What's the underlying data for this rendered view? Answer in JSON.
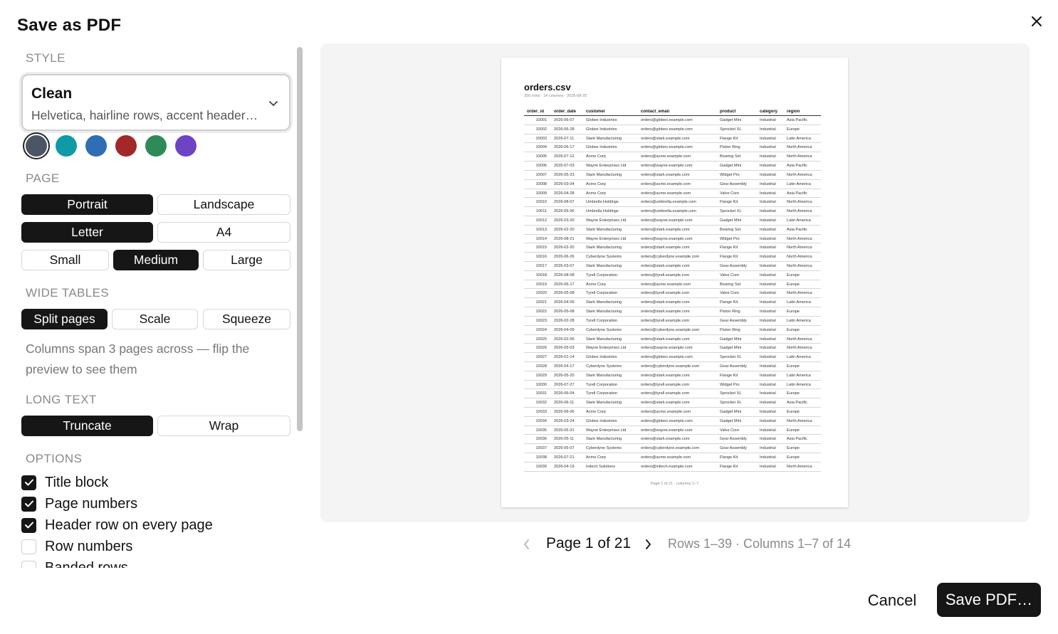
{
  "dialog": {
    "title": "Save as PDF"
  },
  "sections": {
    "style": "STYLE",
    "page": "PAGE",
    "wide_tables": "WIDE TABLES",
    "long_text": "LONG TEXT",
    "options": "OPTIONS"
  },
  "style_picker": {
    "name": "Clean",
    "description": "Helvetica, hairline rows, accent header…"
  },
  "swatches": [
    {
      "name": "slate",
      "color": "#4b5563",
      "selected": true
    },
    {
      "name": "teal",
      "color": "#0e9aa7",
      "selected": false
    },
    {
      "name": "blue",
      "color": "#2f6db5",
      "selected": false
    },
    {
      "name": "red",
      "color": "#a3282a",
      "selected": false
    },
    {
      "name": "green",
      "color": "#2e8b57",
      "selected": false
    },
    {
      "name": "purple",
      "color": "#6c44c4",
      "selected": false
    }
  ],
  "page": {
    "orientation": [
      "Portrait",
      "Landscape"
    ],
    "orientation_selected": "Portrait",
    "paper": [
      "Letter",
      "A4"
    ],
    "paper_selected": "Letter",
    "size": [
      "Small",
      "Medium",
      "Large"
    ],
    "size_selected": "Medium"
  },
  "wide_tables": {
    "modes": [
      "Split pages",
      "Scale",
      "Squeeze"
    ],
    "selected": "Split pages",
    "hint": "Columns span 3 pages across — flip the preview to see them"
  },
  "long_text": {
    "modes": [
      "Truncate",
      "Wrap"
    ],
    "selected": "Truncate"
  },
  "options": [
    {
      "label": "Title block",
      "checked": true
    },
    {
      "label": "Page numbers",
      "checked": true
    },
    {
      "label": "Header row on every page",
      "checked": true
    },
    {
      "label": "Row numbers",
      "checked": false
    },
    {
      "label": "Banded rows",
      "checked": false
    }
  ],
  "preview": {
    "doc_title": "orders.csv",
    "doc_meta": "250 rows · 14 columns · 2026-08-25",
    "columns": [
      "order_id",
      "order_date",
      "customer",
      "contact_email",
      "product",
      "category",
      "region"
    ],
    "rows": [
      [
        "10001",
        "2026-06-07",
        "Globex Industries",
        "orders@globex.example.com",
        "Gadget Mini",
        "Industrial",
        "Asia Pacific"
      ],
      [
        "10002",
        "2026-06-28",
        "Globex Industries",
        "orders@globex.example.com",
        "Sprocket XL",
        "Industrial",
        "Europe"
      ],
      [
        "10003",
        "2026-07-11",
        "Stark Manufacturing",
        "orders@stark.example.com",
        "Flange Kit",
        "Industrial",
        "Latin America"
      ],
      [
        "10004",
        "2026-06-17",
        "Globex Industries",
        "orders@globex.example.com",
        "Piston Ring",
        "Industrial",
        "North America"
      ],
      [
        "10005",
        "2026-07-12",
        "Acme Corp",
        "orders@acme.example.com",
        "Bearing Set",
        "Industrial",
        "North America"
      ],
      [
        "10006",
        "2026-07-03",
        "Wayne Enterprises Ltd",
        "orders@wayne.example.com",
        "Gadget Mini",
        "Industrial",
        "Asia Pacific"
      ],
      [
        "10007",
        "2026-05-23",
        "Stark Manufacturing",
        "orders@stark.example.com",
        "Widget Pro",
        "Industrial",
        "North America"
      ],
      [
        "10008",
        "2026-03-04",
        "Acme Corp",
        "orders@acme.example.com",
        "Gear Assembly",
        "Industrial",
        "Latin America"
      ],
      [
        "10009",
        "2026-04-28",
        "Acme Corp",
        "orders@acme.example.com",
        "Valve Core",
        "Industrial",
        "Asia Pacific"
      ],
      [
        "10010",
        "2026-08-07",
        "Umbrella Holdings",
        "orders@umbrella.example.com",
        "Flange Kit",
        "Industrial",
        "North America"
      ],
      [
        "10011",
        "2026-05-06",
        "Umbrella Holdings",
        "orders@umbrella.example.com",
        "Sprocket XL",
        "Industrial",
        "North America"
      ],
      [
        "10012",
        "2026-03-20",
        "Wayne Enterprises Ltd",
        "orders@wayne.example.com",
        "Gadget Mini",
        "Industrial",
        "Latin America"
      ],
      [
        "10013",
        "2026-02-20",
        "Stark Manufacturing",
        "orders@stark.example.com",
        "Bearing Set",
        "Industrial",
        "Asia Pacific"
      ],
      [
        "10014",
        "2026-08-21",
        "Wayne Enterprises Ltd",
        "orders@wayne.example.com",
        "Widget Pro",
        "Industrial",
        "North America"
      ],
      [
        "10015",
        "2026-02-20",
        "Stark Manufacturing",
        "orders@stark.example.com",
        "Flange Kit",
        "Industrial",
        "North America"
      ],
      [
        "10016",
        "2026-06-26",
        "Cyberdyne Systems",
        "orders@cyberdyne.example.com",
        "Flange Kit",
        "Industrial",
        "North America"
      ],
      [
        "10017",
        "2026-03-07",
        "Stark Manufacturing",
        "orders@stark.example.com",
        "Gear Assembly",
        "Industrial",
        "North America"
      ],
      [
        "10018",
        "2026-08-08",
        "Tyrell Corporation",
        "orders@tyrell.example.com",
        "Valve Core",
        "Industrial",
        "Europe"
      ],
      [
        "10019",
        "2026-06-17",
        "Acme Corp",
        "orders@acme.example.com",
        "Bearing Set",
        "Industrial",
        "Europe"
      ],
      [
        "10020",
        "2026-05-08",
        "Tyrell Corporation",
        "orders@tyrell.example.com",
        "Valve Core",
        "Industrial",
        "North America"
      ],
      [
        "10021",
        "2026-04-05",
        "Stark Manufacturing",
        "orders@stark.example.com",
        "Flange Kit",
        "Industrial",
        "Latin America"
      ],
      [
        "10022",
        "2026-05-08",
        "Stark Manufacturing",
        "orders@stark.example.com",
        "Piston Ring",
        "Industrial",
        "Europe"
      ],
      [
        "10023",
        "2026-02-28",
        "Tyrell Corporation",
        "orders@tyrell.example.com",
        "Gear Assembly",
        "Industrial",
        "Latin America"
      ],
      [
        "10024",
        "2026-04-09",
        "Cyberdyne Systems",
        "orders@cyberdyne.example.com",
        "Piston Ring",
        "Industrial",
        "Europe"
      ],
      [
        "10025",
        "2026-02-06",
        "Stark Manufacturing",
        "orders@stark.example.com",
        "Gadget Mini",
        "Industrial",
        "North America"
      ],
      [
        "10026",
        "2026-05-03",
        "Wayne Enterprises Ltd",
        "orders@wayne.example.com",
        "Gadget Mini",
        "Industrial",
        "North America"
      ],
      [
        "10027",
        "2026-01-14",
        "Globex Industries",
        "orders@globex.example.com",
        "Sprocket XL",
        "Industrial",
        "Latin America"
      ],
      [
        "10028",
        "2026-04-17",
        "Cyberdyne Systems",
        "orders@cyberdyne.example.com",
        "Gear Assembly",
        "Industrial",
        "Europe"
      ],
      [
        "10029",
        "2026-05-20",
        "Stark Manufacturing",
        "orders@stark.example.com",
        "Flange Kit",
        "Industrial",
        "Latin America"
      ],
      [
        "10030",
        "2026-07-27",
        "Tyrell Corporation",
        "orders@tyrell.example.com",
        "Widget Pro",
        "Industrial",
        "Latin America"
      ],
      [
        "10031",
        "2026-06-04",
        "Tyrell Corporation",
        "orders@tyrell.example.com",
        "Sprocket XL",
        "Industrial",
        "Europe"
      ],
      [
        "10032",
        "2026-06-11",
        "Stark Manufacturing",
        "orders@stark.example.com",
        "Sprocket XL",
        "Industrial",
        "Asia Pacific"
      ],
      [
        "10033",
        "2026-06-06",
        "Acme Corp",
        "orders@acme.example.com",
        "Gadget Mini",
        "Industrial",
        "Europe"
      ],
      [
        "10034",
        "2026-03-24",
        "Globex Industries",
        "orders@globex.example.com",
        "Gadget Mini",
        "Industrial",
        "North America"
      ],
      [
        "10035",
        "2026-05-31",
        "Wayne Enterprises Ltd",
        "orders@wayne.example.com",
        "Valve Core",
        "Industrial",
        "Europe"
      ],
      [
        "10036",
        "2026-05-11",
        "Stark Manufacturing",
        "orders@stark.example.com",
        "Gear Assembly",
        "Industrial",
        "Asia Pacific"
      ],
      [
        "10037",
        "2026-05-07",
        "Cyberdyne Systems",
        "orders@cyberdyne.example.com",
        "Gear Assembly",
        "Industrial",
        "Europe"
      ],
      [
        "10038",
        "2026-07-21",
        "Acme Corp",
        "orders@acme.example.com",
        "Flange Kit",
        "Industrial",
        "Europe"
      ],
      [
        "10039",
        "2026-04-19",
        "Initech Solutions",
        "orders@initech.example.com",
        "Flange Kit",
        "Industrial",
        "North America"
      ]
    ],
    "doc_footer": "Page 1 of 21 · columns 1–7"
  },
  "pager": {
    "label": "Page 1 of 21",
    "range": "Rows 1–39 · Columns 1–7 of 14"
  },
  "footer": {
    "cancel": "Cancel",
    "save": "Save PDF…"
  },
  "icons": {
    "close": "close-icon",
    "chevron": "chevron-down-icon",
    "check": "check-icon",
    "prev": "chevron-left-icon",
    "next": "chevron-right-icon"
  }
}
